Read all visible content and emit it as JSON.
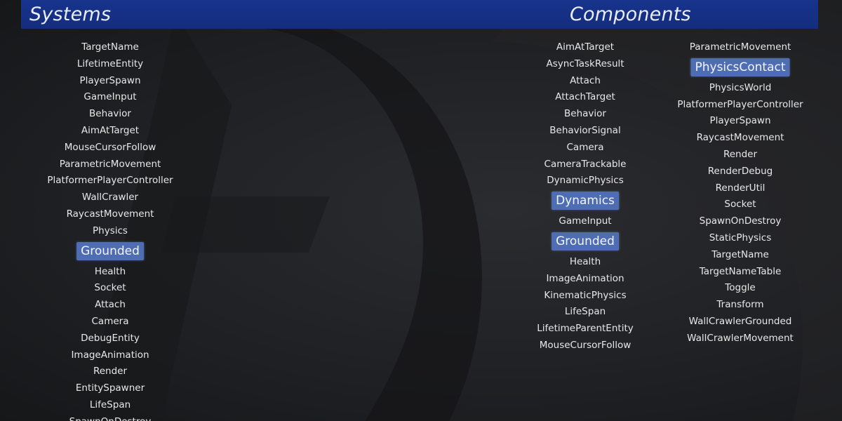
{
  "colors": {
    "header_bar": "#16318a",
    "highlight": "#4f6db3",
    "text": "#e8e8e8",
    "background": "#202124"
  },
  "headers": {
    "left": "Systems",
    "right": "Components"
  },
  "systems": [
    {
      "label": "TargetName",
      "highlighted": false
    },
    {
      "label": "LifetimeEntity",
      "highlighted": false
    },
    {
      "label": "PlayerSpawn",
      "highlighted": false
    },
    {
      "label": "GameInput",
      "highlighted": false
    },
    {
      "label": "Behavior",
      "highlighted": false
    },
    {
      "label": "AimAtTarget",
      "highlighted": false
    },
    {
      "label": "MouseCursorFollow",
      "highlighted": false
    },
    {
      "label": "ParametricMovement",
      "highlighted": false
    },
    {
      "label": "PlatformerPlayerController",
      "highlighted": false
    },
    {
      "label": "WallCrawler",
      "highlighted": false
    },
    {
      "label": "RaycastMovement",
      "highlighted": false
    },
    {
      "label": "Physics",
      "highlighted": false
    },
    {
      "label": "Grounded",
      "highlighted": true
    },
    {
      "label": "Health",
      "highlighted": false
    },
    {
      "label": "Socket",
      "highlighted": false
    },
    {
      "label": "Attach",
      "highlighted": false
    },
    {
      "label": "Camera",
      "highlighted": false
    },
    {
      "label": "DebugEntity",
      "highlighted": false
    },
    {
      "label": "ImageAnimation",
      "highlighted": false
    },
    {
      "label": "Render",
      "highlighted": false
    },
    {
      "label": "EntitySpawner",
      "highlighted": false
    },
    {
      "label": "LifeSpan",
      "highlighted": false
    },
    {
      "label": "SpawnOnDestroy",
      "highlighted": false
    }
  ],
  "components_left": [
    {
      "label": "AimAtTarget",
      "highlighted": false
    },
    {
      "label": "AsyncTaskResult",
      "highlighted": false
    },
    {
      "label": "Attach",
      "highlighted": false
    },
    {
      "label": "AttachTarget",
      "highlighted": false
    },
    {
      "label": "Behavior",
      "highlighted": false
    },
    {
      "label": "BehaviorSignal",
      "highlighted": false
    },
    {
      "label": "Camera",
      "highlighted": false
    },
    {
      "label": "CameraTrackable",
      "highlighted": false
    },
    {
      "label": "DynamicPhysics",
      "highlighted": false
    },
    {
      "label": "Dynamics",
      "highlighted": true
    },
    {
      "label": "GameInput",
      "highlighted": false
    },
    {
      "label": "Grounded",
      "highlighted": true
    },
    {
      "label": "Health",
      "highlighted": false
    },
    {
      "label": "ImageAnimation",
      "highlighted": false
    },
    {
      "label": "KinematicPhysics",
      "highlighted": false
    },
    {
      "label": "LifeSpan",
      "highlighted": false
    },
    {
      "label": "LifetimeParentEntity",
      "highlighted": false
    },
    {
      "label": "MouseCursorFollow",
      "highlighted": false
    }
  ],
  "components_right": [
    {
      "label": "ParametricMovement",
      "highlighted": false
    },
    {
      "label": "PhysicsContact",
      "highlighted": true
    },
    {
      "label": "PhysicsWorld",
      "highlighted": false
    },
    {
      "label": "PlatformerPlayerController",
      "highlighted": false
    },
    {
      "label": "PlayerSpawn",
      "highlighted": false
    },
    {
      "label": "RaycastMovement",
      "highlighted": false
    },
    {
      "label": "Render",
      "highlighted": false
    },
    {
      "label": "RenderDebug",
      "highlighted": false
    },
    {
      "label": "RenderUtil",
      "highlighted": false
    },
    {
      "label": "Socket",
      "highlighted": false
    },
    {
      "label": "SpawnOnDestroy",
      "highlighted": false
    },
    {
      "label": "StaticPhysics",
      "highlighted": false
    },
    {
      "label": "TargetName",
      "highlighted": false
    },
    {
      "label": "TargetNameTable",
      "highlighted": false
    },
    {
      "label": "Toggle",
      "highlighted": false
    },
    {
      "label": "Transform",
      "highlighted": false
    },
    {
      "label": "WallCrawlerGrounded",
      "highlighted": false
    },
    {
      "label": "WallCrawlerMovement",
      "highlighted": false
    }
  ]
}
